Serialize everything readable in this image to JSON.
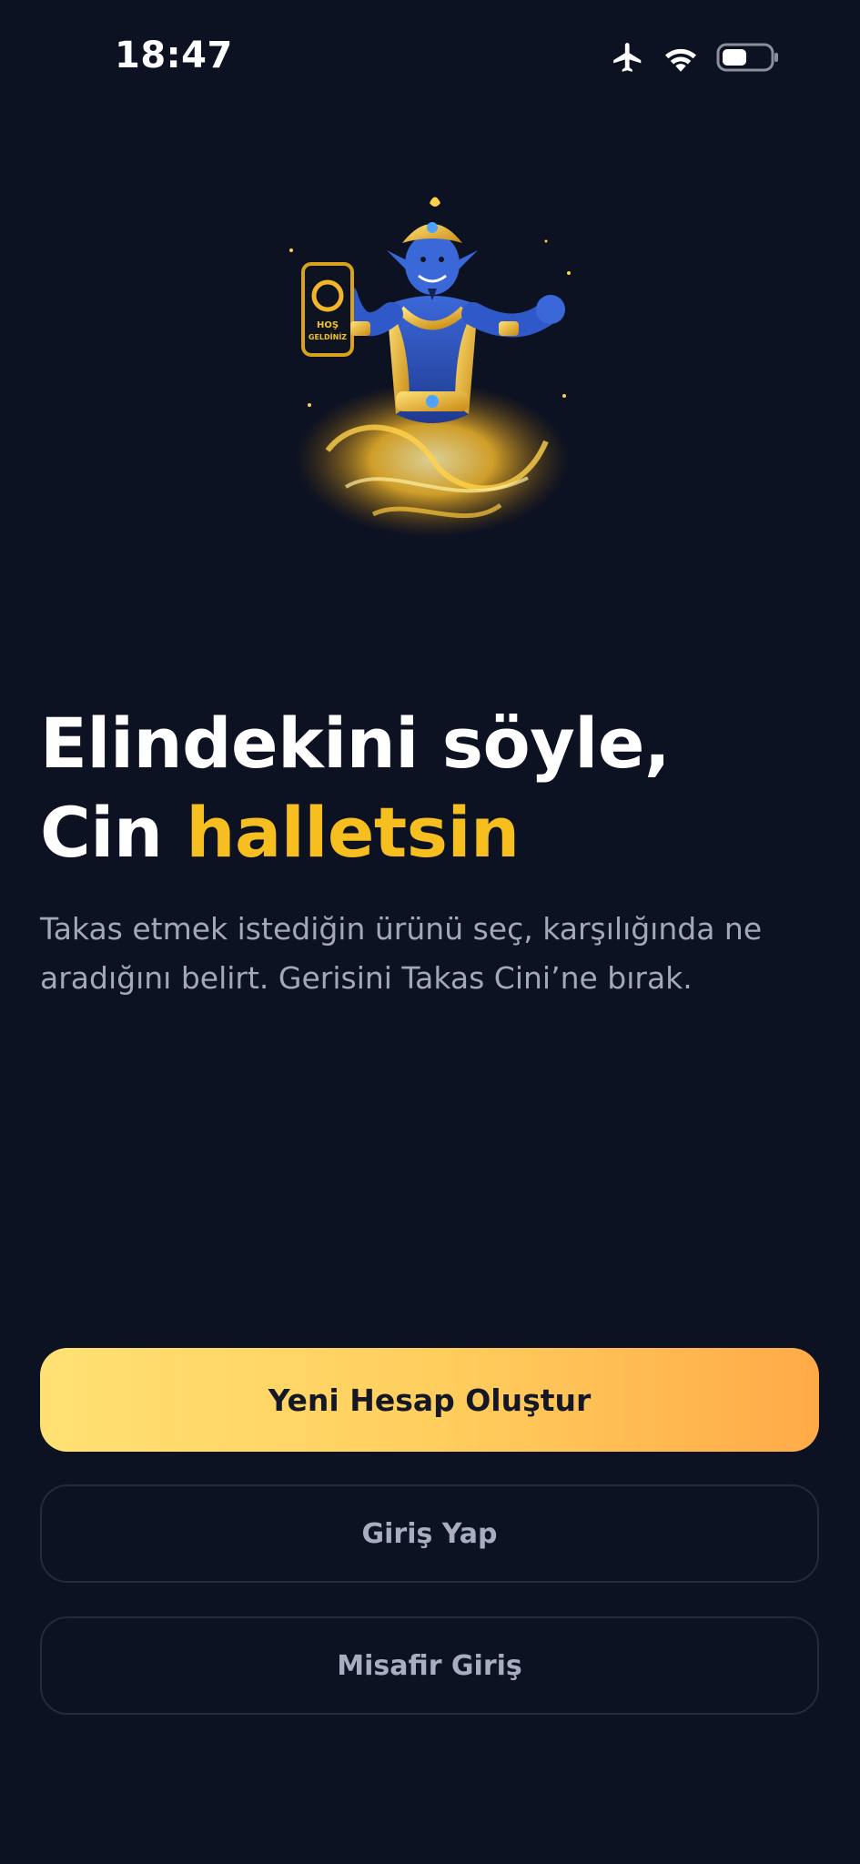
{
  "status_bar": {
    "time": "18:47",
    "icons": [
      "airplane-icon",
      "wifi-icon",
      "battery-icon"
    ]
  },
  "hero": {
    "phone_text_line1": "HOŞ",
    "phone_text_line2": "GELDİNİZ"
  },
  "headline": {
    "line1": "Elindekini söyle,",
    "line2_prefix": "Cin ",
    "line2_accent": "halletsin"
  },
  "subtext": "Takas etmek istediğin ürünü seç, karşılığında ne aradığını belirt. Gerisini Takas Cini’ne bırak.",
  "buttons": {
    "primary": "Yeni Hesap Oluştur",
    "login": "Giriş Yap",
    "guest": "Misafir Giriş"
  },
  "colors": {
    "background": "#0d1222",
    "accent": "#f6be1e",
    "primary_gradient_start": "#ffe173",
    "primary_gradient_end": "#ffaa48"
  }
}
